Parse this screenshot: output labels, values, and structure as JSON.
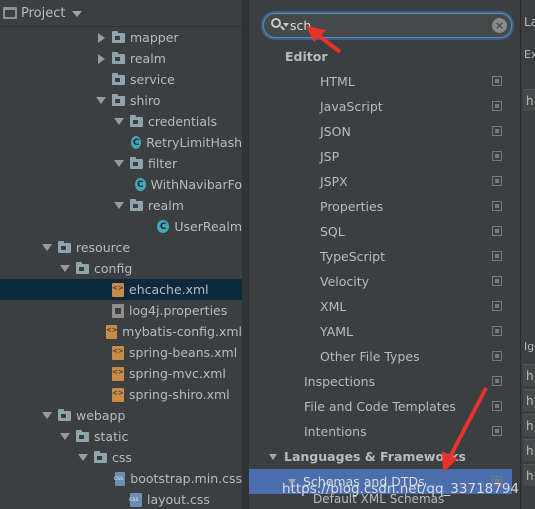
{
  "project": {
    "title": "Project",
    "tree": [
      {
        "label": "mapper",
        "type": "folder",
        "level": 5,
        "expanded": false
      },
      {
        "label": "realm",
        "type": "folder",
        "level": 5,
        "expanded": false
      },
      {
        "label": "service",
        "type": "folder",
        "level": 5,
        "expanded": null
      },
      {
        "label": "shiro",
        "type": "folder",
        "level": 5,
        "expanded": true
      },
      {
        "label": "credentials",
        "type": "folder",
        "level": 6,
        "expanded": true
      },
      {
        "label": "RetryLimitHash",
        "type": "class",
        "level": 8,
        "expanded": null
      },
      {
        "label": "filter",
        "type": "folder",
        "level": 6,
        "expanded": true
      },
      {
        "label": "WithNavibarFo",
        "type": "class",
        "level": 8,
        "expanded": null
      },
      {
        "label": "realm",
        "type": "folder",
        "level": 6,
        "expanded": true
      },
      {
        "label": "UserRealm",
        "type": "class",
        "level": 8,
        "expanded": null
      },
      {
        "label": "resource",
        "type": "folder",
        "level": 2,
        "expanded": true
      },
      {
        "label": "config",
        "type": "folder",
        "level": 3,
        "expanded": true
      },
      {
        "label": "ehcache.xml",
        "type": "xml",
        "level": 5,
        "expanded": null,
        "selected": true
      },
      {
        "label": "log4j.properties",
        "type": "prop",
        "level": 5,
        "expanded": null
      },
      {
        "label": "mybatis-config.xml",
        "type": "xml",
        "level": 5,
        "expanded": null
      },
      {
        "label": "spring-beans.xml",
        "type": "xml",
        "level": 5,
        "expanded": null
      },
      {
        "label": "spring-mvc.xml",
        "type": "xml",
        "level": 5,
        "expanded": null
      },
      {
        "label": "spring-shiro.xml",
        "type": "xml",
        "level": 5,
        "expanded": null
      },
      {
        "label": "webapp",
        "type": "folder",
        "level": 2,
        "expanded": true
      },
      {
        "label": "static",
        "type": "folder",
        "level": 3,
        "expanded": true
      },
      {
        "label": "css",
        "type": "folder",
        "level": 4,
        "expanded": true
      },
      {
        "label": "bootstrap.min.css",
        "type": "css",
        "level": 6,
        "expanded": null
      },
      {
        "label": "layout.css",
        "type": "css",
        "level": 6,
        "expanded": null
      }
    ]
  },
  "settings": {
    "search_value": "sch",
    "clear_glyph": "×",
    "items": [
      {
        "label": "Editor",
        "level": 0,
        "bold": true
      },
      {
        "label": "HTML",
        "level": 2
      },
      {
        "label": "JavaScript",
        "level": 2
      },
      {
        "label": "JSON",
        "level": 2
      },
      {
        "label": "JSP",
        "level": 2
      },
      {
        "label": "JSPX",
        "level": 2
      },
      {
        "label": "Properties",
        "level": 2
      },
      {
        "label": "SQL",
        "level": 2
      },
      {
        "label": "TypeScript",
        "level": 2
      },
      {
        "label": "Velocity",
        "level": 2
      },
      {
        "label": "XML",
        "level": 2
      },
      {
        "label": "YAML",
        "level": 2
      },
      {
        "label": "Other File Types",
        "level": 2
      },
      {
        "label": "Inspections",
        "level": 1
      },
      {
        "label": "File and Code Templates",
        "level": 1
      },
      {
        "label": "Intentions",
        "level": 1
      },
      {
        "label": "Languages & Frameworks",
        "level": 0,
        "bold": true,
        "arrow": true
      },
      {
        "label": "Schemas and DTDs",
        "level": 1,
        "arrow": true,
        "selected": true
      }
    ],
    "overlap_item": "Default XML Schemas"
  },
  "right_panel": {
    "header": "La",
    "sub_header": "Ex",
    "section": "Igr",
    "cell_letter": "h"
  },
  "watermark": "https://blog.csdn.net/qq_33718794",
  "colors": {
    "selection_blue": "#4b6eaf",
    "annotation_red": "#e8322a",
    "tree_selected": "#0d293e"
  }
}
